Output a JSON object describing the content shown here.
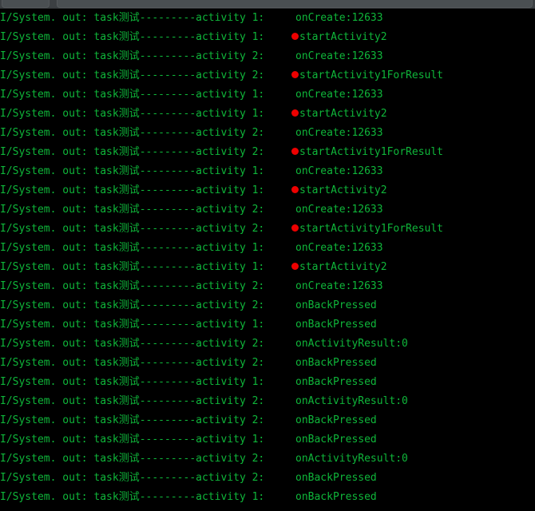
{
  "toolbar": {
    "name": "logcat-toolbar-strip",
    "background_color": "#3c4043",
    "chip_a_label": "",
    "chip_b_label": ""
  },
  "console": {
    "background_color": "#000000",
    "text_color": "#0fb63a",
    "marker_color": "#ee0000",
    "prefix": "I/System. out: task测试---------",
    "activity_label_1": "activity 1:",
    "activity_label_2": "activity 2:",
    "lines": [
      {
        "prefix": "I/System. out: task测试---------",
        "activity": "activity 1:",
        "message": "onCreate:12633",
        "marked": false
      },
      {
        "prefix": "I/System. out: task测试---------",
        "activity": "activity 1:",
        "message": "startActivity2",
        "marked": true
      },
      {
        "prefix": "I/System. out: task测试---------",
        "activity": "activity 2:",
        "message": "onCreate:12633",
        "marked": false
      },
      {
        "prefix": "I/System. out: task测试---------",
        "activity": "activity 2:",
        "message": "startActivity1ForResult",
        "marked": true
      },
      {
        "prefix": "I/System. out: task测试---------",
        "activity": "activity 1:",
        "message": "onCreate:12633",
        "marked": false
      },
      {
        "prefix": "I/System. out: task测试---------",
        "activity": "activity 1:",
        "message": "startActivity2",
        "marked": true
      },
      {
        "prefix": "I/System. out: task测试---------",
        "activity": "activity 2:",
        "message": "onCreate:12633",
        "marked": false
      },
      {
        "prefix": "I/System. out: task测试---------",
        "activity": "activity 2:",
        "message": "startActivity1ForResult",
        "marked": true
      },
      {
        "prefix": "I/System. out: task测试---------",
        "activity": "activity 1:",
        "message": "onCreate:12633",
        "marked": false
      },
      {
        "prefix": "I/System. out: task测试---------",
        "activity": "activity 1:",
        "message": "startActivity2",
        "marked": true
      },
      {
        "prefix": "I/System. out: task测试---------",
        "activity": "activity 2:",
        "message": "onCreate:12633",
        "marked": false
      },
      {
        "prefix": "I/System. out: task测试---------",
        "activity": "activity 2:",
        "message": "startActivity1ForResult",
        "marked": true
      },
      {
        "prefix": "I/System. out: task测试---------",
        "activity": "activity 1:",
        "message": "onCreate:12633",
        "marked": false
      },
      {
        "prefix": "I/System. out: task测试---------",
        "activity": "activity 1:",
        "message": "startActivity2",
        "marked": true
      },
      {
        "prefix": "I/System. out: task测试---------",
        "activity": "activity 2:",
        "message": "onCreate:12633",
        "marked": false
      },
      {
        "prefix": "I/System. out: task测试---------",
        "activity": "activity 2:",
        "message": "onBackPressed",
        "marked": false
      },
      {
        "prefix": "I/System. out: task测试---------",
        "activity": "activity 1:",
        "message": "onBackPressed",
        "marked": false
      },
      {
        "prefix": "I/System. out: task测试---------",
        "activity": "activity 2:",
        "message": "onActivityResult:0",
        "marked": false
      },
      {
        "prefix": "I/System. out: task测试---------",
        "activity": "activity 2:",
        "message": "onBackPressed",
        "marked": false
      },
      {
        "prefix": "I/System. out: task测试---------",
        "activity": "activity 1:",
        "message": "onBackPressed",
        "marked": false
      },
      {
        "prefix": "I/System. out: task测试---------",
        "activity": "activity 2:",
        "message": "onActivityResult:0",
        "marked": false
      },
      {
        "prefix": "I/System. out: task测试---------",
        "activity": "activity 2:",
        "message": "onBackPressed",
        "marked": false
      },
      {
        "prefix": "I/System. out: task测试---------",
        "activity": "activity 1:",
        "message": "onBackPressed",
        "marked": false
      },
      {
        "prefix": "I/System. out: task测试---------",
        "activity": "activity 2:",
        "message": "onActivityResult:0",
        "marked": false
      },
      {
        "prefix": "I/System. out: task测试---------",
        "activity": "activity 2:",
        "message": "onBackPressed",
        "marked": false
      },
      {
        "prefix": "I/System. out: task测试---------",
        "activity": "activity 1:",
        "message": "onBackPressed",
        "marked": false
      }
    ]
  }
}
